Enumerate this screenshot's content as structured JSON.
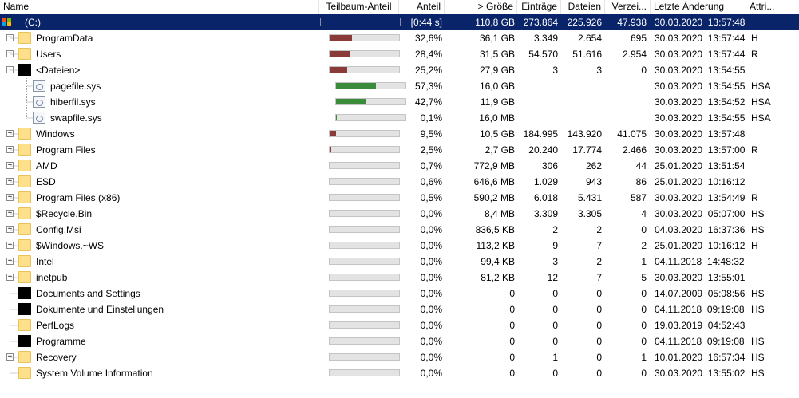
{
  "header": {
    "name": "Name",
    "subtree": "Teilbaum-Anteil",
    "percent": "Anteil",
    "size": "> Größe",
    "entries": "Einträge",
    "files": "Dateien",
    "dirs": "Verzei...",
    "modified": "Letzte Änderung",
    "attr": "Attri..."
  },
  "colors": {
    "selected_bg": "#0a246a",
    "bar_dir": "#8b3a3a",
    "bar_file": "#3a8b3a",
    "bar_bg": "#e3e3e3",
    "folder": "#ffe08a"
  },
  "rows": [
    {
      "name": "(C:)",
      "icon": "drive",
      "depth": 0,
      "expander": "",
      "selected": true,
      "bar": null,
      "percent": "[0:44 s]",
      "size": "110,8 GB",
      "entries": "273.864",
      "files": "225.926",
      "dirs": "47.938",
      "modified": "30.03.2020  13:57:48",
      "attr": ""
    },
    {
      "name": "ProgramData",
      "icon": "folder",
      "depth": 1,
      "expander": "+",
      "bar": 0.326,
      "barColor": "dir",
      "percent": "32,6%",
      "size": "36,1 GB",
      "entries": "3.349",
      "files": "2.654",
      "dirs": "695",
      "modified": "30.03.2020  13:57:44",
      "attr": "H"
    },
    {
      "name": "Users",
      "icon": "folder",
      "depth": 1,
      "expander": "+",
      "bar": 0.284,
      "barColor": "dir",
      "percent": "28,4%",
      "size": "31,5 GB",
      "entries": "54.570",
      "files": "51.616",
      "dirs": "2.954",
      "modified": "30.03.2020  13:57:44",
      "attr": "R"
    },
    {
      "name": "<Dateien>",
      "icon": "black",
      "depth": 1,
      "expander": "-",
      "bar": 0.252,
      "barColor": "dir",
      "percent": "25,2%",
      "size": "27,9 GB",
      "entries": "3",
      "files": "3",
      "dirs": "0",
      "modified": "30.03.2020  13:54:55",
      "attr": ""
    },
    {
      "name": "pagefile.sys",
      "icon": "file",
      "depth": 2,
      "expander": "",
      "bar": 0.573,
      "barColor": "file",
      "percent": "57,3%",
      "size": "16,0 GB",
      "entries": "",
      "files": "",
      "dirs": "",
      "modified": "30.03.2020  13:54:55",
      "attr": "HSA"
    },
    {
      "name": "hiberfil.sys",
      "icon": "file",
      "depth": 2,
      "expander": "",
      "bar": 0.427,
      "barColor": "file",
      "percent": "42,7%",
      "size": "11,9 GB",
      "entries": "",
      "files": "",
      "dirs": "",
      "modified": "30.03.2020  13:54:52",
      "attr": "HSA"
    },
    {
      "name": "swapfile.sys",
      "icon": "file",
      "depth": 2,
      "expander": "",
      "bar": 0.001,
      "barColor": "file",
      "percent": "0,1%",
      "size": "16,0 MB",
      "entries": "",
      "files": "",
      "dirs": "",
      "modified": "30.03.2020  13:54:55",
      "attr": "HSA"
    },
    {
      "name": "Windows",
      "icon": "folder",
      "depth": 1,
      "expander": "+",
      "bar": 0.095,
      "barColor": "dir",
      "percent": "9,5%",
      "size": "10,5 GB",
      "entries": "184.995",
      "files": "143.920",
      "dirs": "41.075",
      "modified": "30.03.2020  13:57:48",
      "attr": ""
    },
    {
      "name": "Program Files",
      "icon": "folder",
      "depth": 1,
      "expander": "+",
      "bar": 0.025,
      "barColor": "dir",
      "percent": "2,5%",
      "size": "2,7 GB",
      "entries": "20.240",
      "files": "17.774",
      "dirs": "2.466",
      "modified": "30.03.2020  13:57:00",
      "attr": "R"
    },
    {
      "name": "AMD",
      "icon": "folder",
      "depth": 1,
      "expander": "+",
      "bar": 0.007,
      "barColor": "dir",
      "percent": "0,7%",
      "size": "772,9 MB",
      "entries": "306",
      "files": "262",
      "dirs": "44",
      "modified": "25.01.2020  13:51:54",
      "attr": ""
    },
    {
      "name": "ESD",
      "icon": "folder",
      "depth": 1,
      "expander": "+",
      "bar": 0.006,
      "barColor": "dir",
      "percent": "0,6%",
      "size": "646,6 MB",
      "entries": "1.029",
      "files": "943",
      "dirs": "86",
      "modified": "25.01.2020  10:16:12",
      "attr": ""
    },
    {
      "name": "Program Files (x86)",
      "icon": "folder",
      "depth": 1,
      "expander": "+",
      "bar": 0.005,
      "barColor": "dir",
      "percent": "0,5%",
      "size": "590,2 MB",
      "entries": "6.018",
      "files": "5.431",
      "dirs": "587",
      "modified": "30.03.2020  13:54:49",
      "attr": "R"
    },
    {
      "name": "$Recycle.Bin",
      "icon": "folder",
      "depth": 1,
      "expander": "+",
      "bar": 0.0,
      "barColor": "dir",
      "percent": "0,0%",
      "size": "8,4 MB",
      "entries": "3.309",
      "files": "3.305",
      "dirs": "4",
      "modified": "30.03.2020  05:07:00",
      "attr": "HS"
    },
    {
      "name": "Config.Msi",
      "icon": "folder",
      "depth": 1,
      "expander": "+",
      "bar": 0.0,
      "barColor": "dir",
      "percent": "0,0%",
      "size": "836,5 KB",
      "entries": "2",
      "files": "2",
      "dirs": "0",
      "modified": "04.03.2020  16:37:36",
      "attr": "HS"
    },
    {
      "name": "$Windows.~WS",
      "icon": "folder",
      "depth": 1,
      "expander": "+",
      "bar": 0.0,
      "barColor": "dir",
      "percent": "0,0%",
      "size": "113,2 KB",
      "entries": "9",
      "files": "7",
      "dirs": "2",
      "modified": "25.01.2020  10:16:12",
      "attr": "H"
    },
    {
      "name": "Intel",
      "icon": "folder",
      "depth": 1,
      "expander": "+",
      "bar": 0.0,
      "barColor": "dir",
      "percent": "0,0%",
      "size": "99,4 KB",
      "entries": "3",
      "files": "2",
      "dirs": "1",
      "modified": "04.11.2018  14:48:32",
      "attr": ""
    },
    {
      "name": "inetpub",
      "icon": "folder",
      "depth": 1,
      "expander": "+",
      "bar": 0.0,
      "barColor": "dir",
      "percent": "0,0%",
      "size": "81,2 KB",
      "entries": "12",
      "files": "7",
      "dirs": "5",
      "modified": "30.03.2020  13:55:01",
      "attr": ""
    },
    {
      "name": "Documents and Settings",
      "icon": "black",
      "depth": 1,
      "expander": "",
      "bar": 0.0,
      "barColor": "dir",
      "percent": "0,0%",
      "size": "0",
      "entries": "0",
      "files": "0",
      "dirs": "0",
      "modified": "14.07.2009  05:08:56",
      "attr": "HS"
    },
    {
      "name": "Dokumente und Einstellungen",
      "icon": "black",
      "depth": 1,
      "expander": "",
      "bar": 0.0,
      "barColor": "dir",
      "percent": "0,0%",
      "size": "0",
      "entries": "0",
      "files": "0",
      "dirs": "0",
      "modified": "04.11.2018  09:19:08",
      "attr": "HS"
    },
    {
      "name": "PerfLogs",
      "icon": "folder",
      "depth": 1,
      "expander": "",
      "bar": 0.0,
      "barColor": "dir",
      "percent": "0,0%",
      "size": "0",
      "entries": "0",
      "files": "0",
      "dirs": "0",
      "modified": "19.03.2019  04:52:43",
      "attr": ""
    },
    {
      "name": "Programme",
      "icon": "black",
      "depth": 1,
      "expander": "",
      "bar": 0.0,
      "barColor": "dir",
      "percent": "0,0%",
      "size": "0",
      "entries": "0",
      "files": "0",
      "dirs": "0",
      "modified": "04.11.2018  09:19:08",
      "attr": "HS"
    },
    {
      "name": "Recovery",
      "icon": "folder",
      "depth": 1,
      "expander": "+",
      "bar": 0.0,
      "barColor": "dir",
      "percent": "0,0%",
      "size": "0",
      "entries": "1",
      "files": "0",
      "dirs": "1",
      "modified": "10.01.2020  16:57:34",
      "attr": "HS"
    },
    {
      "name": "System Volume Information",
      "icon": "folder",
      "depth": 1,
      "expander": "",
      "bar": 0.0,
      "barColor": "dir",
      "percent": "0,0%",
      "size": "0",
      "entries": "0",
      "files": "0",
      "dirs": "0",
      "modified": "30.03.2020  13:55:02",
      "attr": "HS"
    }
  ]
}
